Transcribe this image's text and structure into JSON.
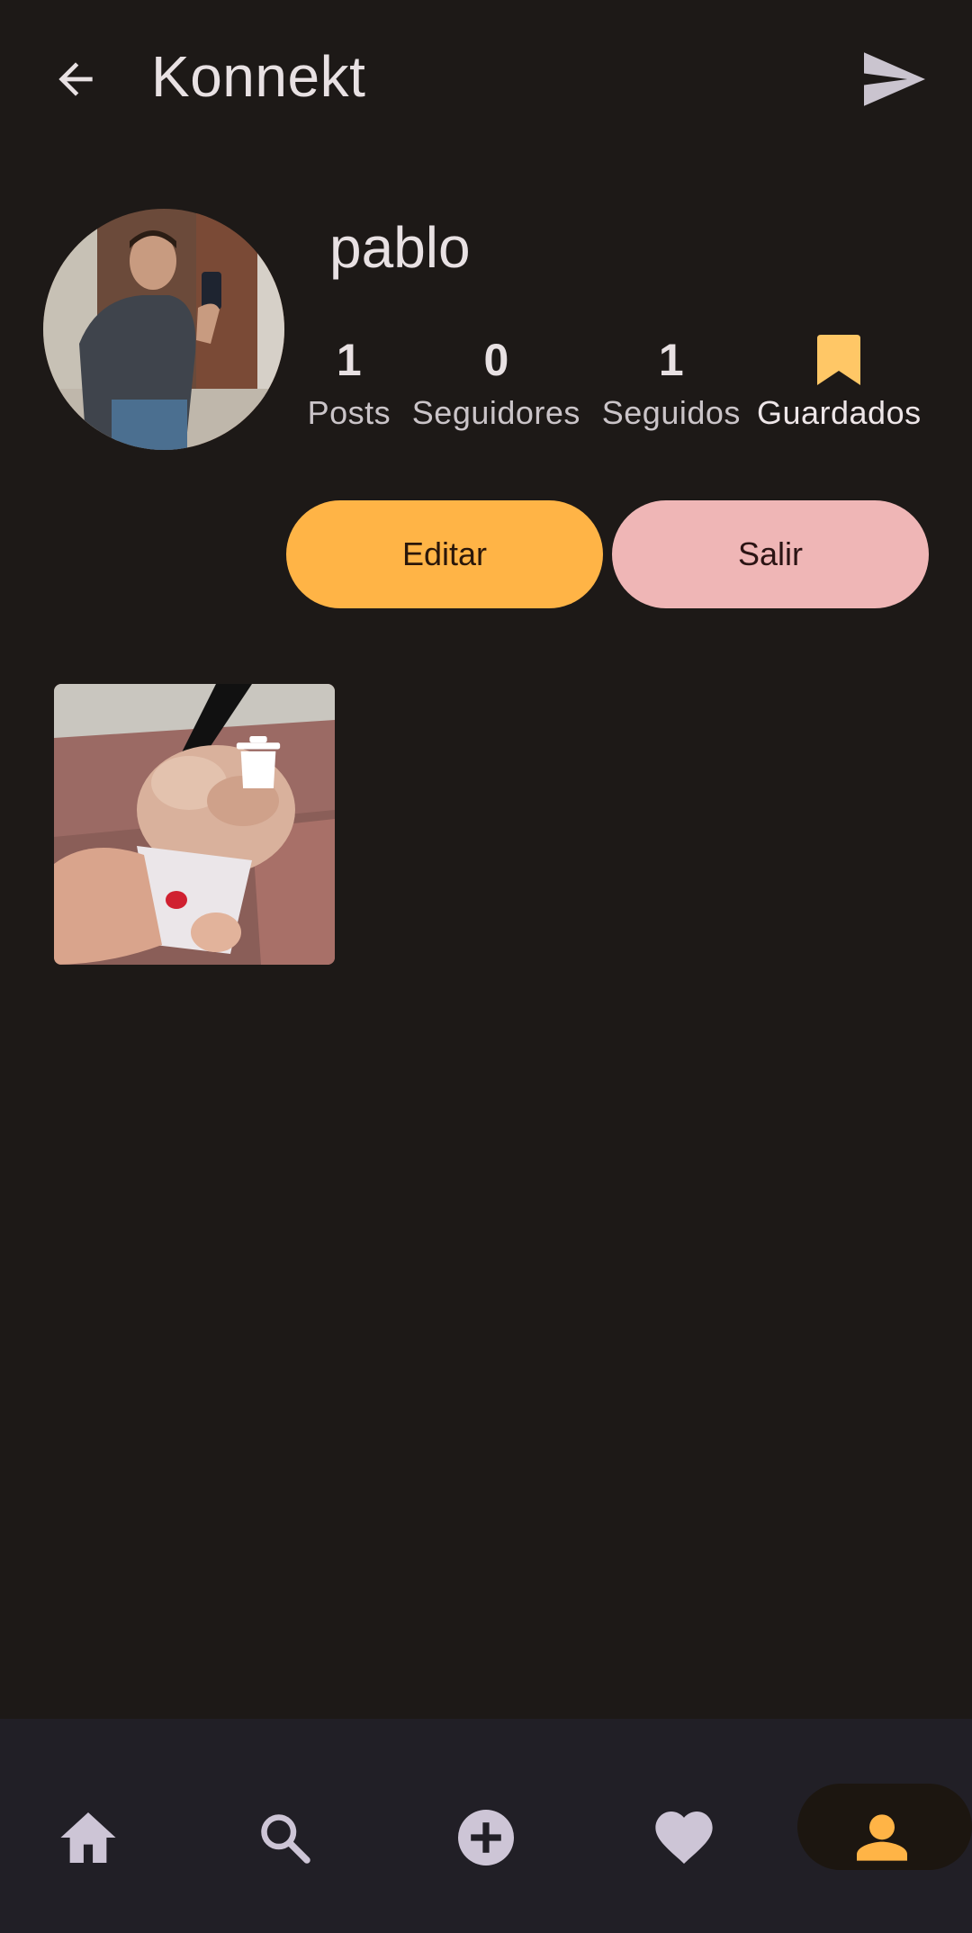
{
  "header": {
    "title": "Konnekt",
    "back_icon": "arrow-back-icon",
    "send_icon": "send-icon"
  },
  "profile": {
    "username": "pablo",
    "avatar_alt": "profile photo"
  },
  "stats": {
    "posts": {
      "value": "1",
      "label": "Posts"
    },
    "followers": {
      "value": "0",
      "label": "Seguidores"
    },
    "following": {
      "value": "1",
      "label": "Seguidos"
    },
    "saved": {
      "icon": "bookmark-icon",
      "label": "Guardados"
    }
  },
  "actions": {
    "edit_label": "Editar",
    "exit_label": "Salir"
  },
  "posts": [
    {
      "icon": "delete-icon"
    }
  ],
  "bottom_nav": {
    "items": [
      "home-icon",
      "search-icon",
      "add-circle-icon",
      "heart-icon",
      "person-icon"
    ],
    "active": "person-icon"
  },
  "colors": {
    "background": "#1d1917",
    "accent": "#ffb446",
    "secondary": "#efb6b6",
    "nav_background": "#211f26"
  }
}
